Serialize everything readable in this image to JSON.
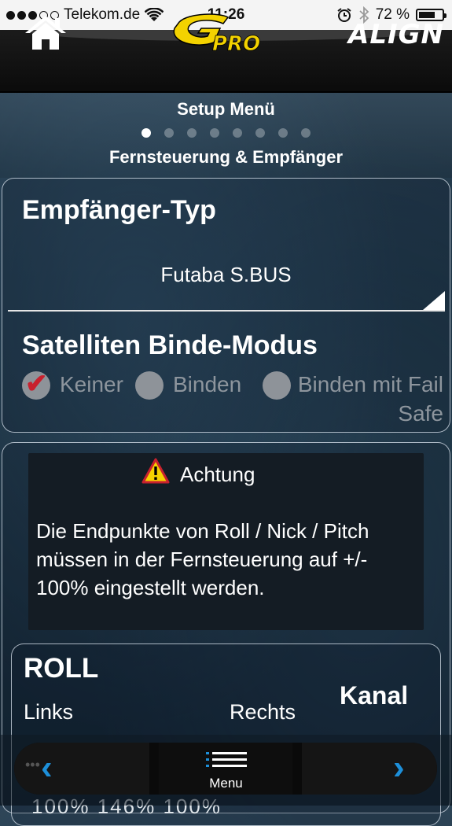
{
  "status_bar": {
    "carrier": "Telekom.de",
    "time": "11:26",
    "battery_percent": "72 %",
    "battery_level": 0.72
  },
  "nav": {
    "home_icon": "home-icon",
    "brand_logo": "GPRO",
    "brand_right": "ALIGN"
  },
  "setup": {
    "title": "Setup Menü",
    "page_count": 8,
    "active_page": 1,
    "section": "Fernsteuerung & Empfänger"
  },
  "receiver": {
    "label": "Empfänger-Typ",
    "value": "Futaba S.BUS"
  },
  "satellite": {
    "label": "Satelliten Binde-Modus",
    "options": [
      {
        "label": "Keiner",
        "selected": true
      },
      {
        "label": "Binden",
        "selected": false
      },
      {
        "label": "Binden mit Fail Safe",
        "selected": false
      }
    ]
  },
  "warning": {
    "icon": "warning-icon",
    "title": "Achtung",
    "text": "Die Endpunkte von Roll / Nick / Pitch müssen in der Fernsteuerung auf +/- 100% eingestellt werden."
  },
  "roll": {
    "title": "ROLL",
    "left_label": "Links",
    "right_label": "Rechts",
    "channel_label": "Kanal",
    "partial_values": "100%   146%   100%"
  },
  "toolbar": {
    "prev_icon": "chevron-left-icon",
    "menu_icon": "menu-icon",
    "menu_label": "Menu",
    "next_icon": "chevron-right-icon",
    "accent_color": "#1d8fd9"
  }
}
